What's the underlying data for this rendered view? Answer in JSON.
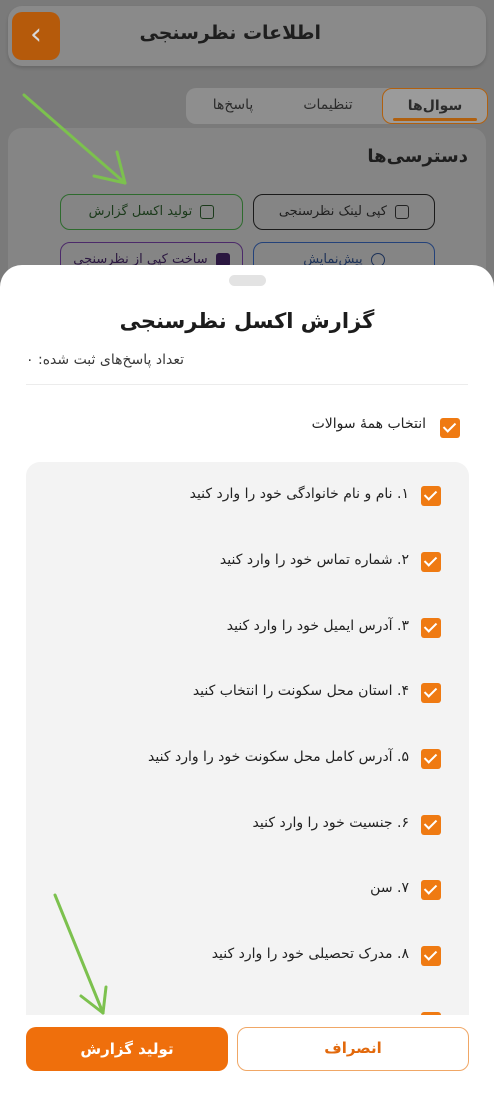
{
  "header": {
    "title": "اطلاعات نظرسنجی",
    "back_icon": "chevron-left-icon"
  },
  "tabs": [
    {
      "label": "سوال‌ها",
      "active": true
    },
    {
      "label": "تنظیمات",
      "active": false
    },
    {
      "label": "پاسخ‌ها",
      "active": false
    }
  ],
  "access": {
    "title": "دسترسی‌ها",
    "copy_link": "کپی لینک نظرسنجی",
    "excel_report": "تولید اکسل گزارش",
    "preview": "پیش‌نمایش",
    "duplicate": "ساخت کپی از نظرسنجی"
  },
  "sheet": {
    "title": "گزارش اکسل نظرسنجی",
    "responses_count": "تعداد پاسخ‌های ثبت شده: ۰",
    "select_all_label": "انتخاب همهٔ سوالات",
    "questions": [
      "۱. نام و نام خانوادگی خود را وارد کنید",
      "۲. شماره تماس خود را وارد کنید",
      "۳. آدرس ایمیل خود را وارد کنید",
      "۴. استان محل سکونت را انتخاب کنید",
      "۵. آدرس کامل محل سکونت خود را وارد کنید",
      "۶. جنسیت خود را وارد کنید",
      "۷. سن",
      "۸. مدرک تحصیلی خود را وارد کنید"
    ],
    "generate_button": "تولید گزارش",
    "cancel_button": "انصراف"
  },
  "colors": {
    "accent": "#ef7a12",
    "primary_button": "#ef6f0c",
    "annotation_arrow": "#7cc14e"
  }
}
